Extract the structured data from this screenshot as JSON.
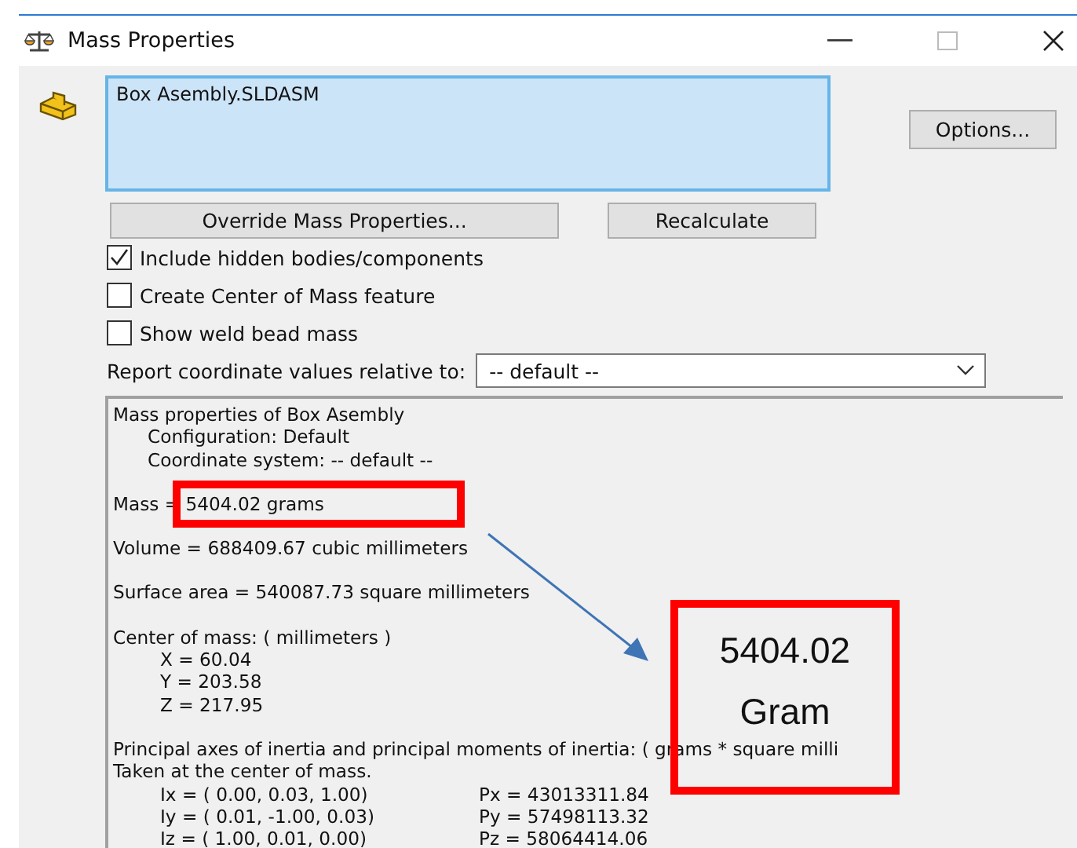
{
  "window": {
    "title": "Mass Properties"
  },
  "selection": {
    "value": "Box Asembly.SLDASM"
  },
  "buttons": {
    "options": "Options...",
    "override": "Override Mass Properties...",
    "recalculate": "Recalculate"
  },
  "checkboxes": [
    {
      "label": "Include hidden bodies/components",
      "checked": true
    },
    {
      "label": "Create Center of Mass feature",
      "checked": false
    },
    {
      "label": "Show weld bead mass",
      "checked": false
    }
  ],
  "coordinate_report": {
    "label": "Report coordinate values relative to:",
    "value": "-- default --"
  },
  "report": {
    "sections": [
      {
        "headings": [
          "Mass properties of Box Asembly"
        ],
        "items": [
          "Configuration: Default",
          "Coordinate system: -- default --"
        ]
      },
      {
        "headings": [
          "Mass = 5404.02 grams"
        ]
      },
      {
        "headings": [
          "Volume = 688409.67 cubic millimeters"
        ]
      },
      {
        "headings": [
          "Surface area = 540087.73  square millimeters"
        ]
      },
      {
        "headings": [
          "Center of mass: ( millimeters )"
        ],
        "items": [
          "X = 60.04",
          "Y = 203.58",
          "Z = 217.95"
        ]
      },
      {
        "headings": [
          "Principal axes of inertia and principal moments of inertia: ( grams *  square milli",
          "Taken at the center of mass."
        ],
        "rows": [
          {
            "axis": "Ix = ( 0.00,  0.03,  1.00)",
            "moment": "Px = 43013311.84"
          },
          {
            "axis": "Iy = ( 0.01, -1.00,  0.03)",
            "moment": "Py = 57498113.32"
          },
          {
            "axis": "Iz = ( 1.00,  0.01,  0.00)",
            "moment": "Pz = 58064414.06"
          }
        ]
      }
    ]
  },
  "callout": {
    "value": "5404.02",
    "unit": "Gram"
  }
}
